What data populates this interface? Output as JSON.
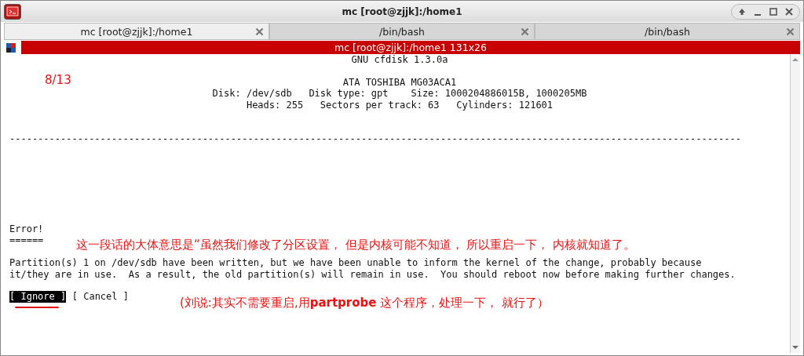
{
  "window": {
    "title": "mc [root@zjjk]:/home1"
  },
  "tabs": [
    {
      "label": "mc [root@zjjk]:/home1",
      "selected": true
    },
    {
      "label": "/bin/bash",
      "selected": false
    },
    {
      "label": "/bin/bash",
      "selected": false
    }
  ],
  "terminal": {
    "title": "mc [root@zjjk]:/home1 131x26",
    "header": "GNU cfdisk 1.3.0a",
    "disk_info": [
      "ATA TOSHIBA MG03ACA1",
      "Disk: /dev/sdb   Disk type: gpt    Size: 1000204886015B, 1000205MB",
      "Heads: 255   Sectors per track: 63   Cylinders: 121601"
    ],
    "separator": "---------------------------------------------------------------------------------------------------------------------------------",
    "message": {
      "title": "Error!",
      "underline": "======",
      "body": [
        "Partition(s) 1 on /dev/sdb have been written, but we have been unable to inform the kernel of the change, probably because",
        "it/they are in use.  As a result, the old partition(s) will remain in use.  You should reboot now before making further changes."
      ]
    },
    "buttons": [
      {
        "label": "[ Ignore ]",
        "selected": true
      },
      {
        "label": "[ Cancel ]",
        "selected": false
      }
    ]
  },
  "annotations": [
    {
      "text": "8/13"
    },
    {
      "text": "这一段话的大体意思是“虽然我们修改了分区设置， 但是内核可能不知道， 所以重启一下， 内核就知道了。"
    },
    {
      "text": "(刘说:其实不需要重启,用**partprobe** 这个程序，处理一下， 就行了）"
    }
  ]
}
